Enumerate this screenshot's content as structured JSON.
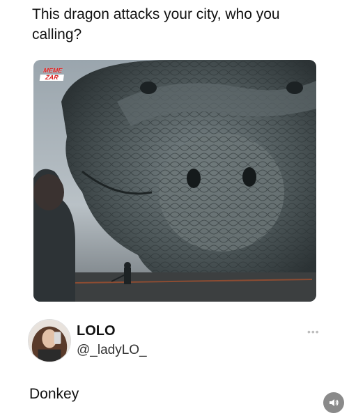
{
  "post": {
    "text": "This dragon attacks your city, who you calling?",
    "watermark": [
      "MEME",
      "ZAR"
    ]
  },
  "reply": {
    "display_name": "LOLO",
    "handle": "@_ladyLO_",
    "text": "Donkey",
    "more_icon": "more-dots-icon"
  },
  "controls": {
    "sound_icon": "speaker-icon"
  }
}
